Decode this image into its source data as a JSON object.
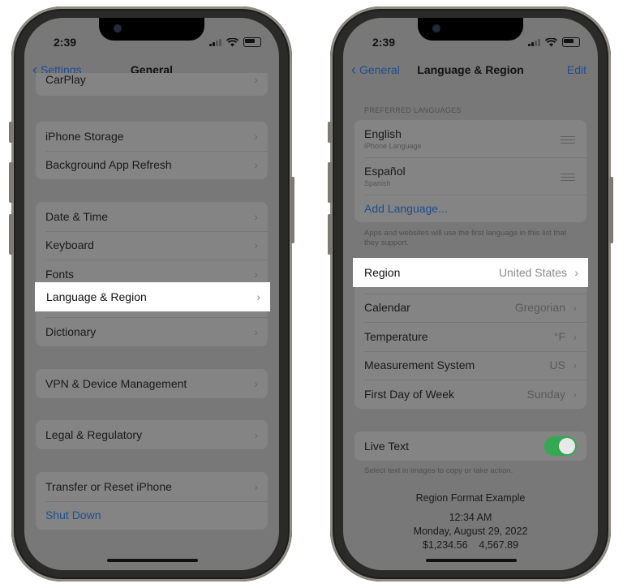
{
  "left_phone": {
    "status": {
      "time": "2:39"
    },
    "nav": {
      "back_label": "Settings",
      "title": "General"
    },
    "partial_row": "CarPlay",
    "group1": [
      "iPhone Storage",
      "Background App Refresh"
    ],
    "group2": [
      "Date & Time",
      "Keyboard",
      "Fonts",
      "Language & Region",
      "Dictionary"
    ],
    "group3": [
      "VPN & Device Management"
    ],
    "group4": [
      "Legal & Regulatory"
    ],
    "group5": [
      "Transfer or Reset iPhone"
    ],
    "shut_down": "Shut Down"
  },
  "right_phone": {
    "status": {
      "time": "2:39"
    },
    "nav": {
      "back_label": "General",
      "title": "Language & Region",
      "edit_label": "Edit"
    },
    "preferred_header": "PREFERRED LANGUAGES",
    "languages": [
      {
        "name": "English",
        "sub": "iPhone Language"
      },
      {
        "name": "Español",
        "sub": "Spanish"
      }
    ],
    "add_language": "Add Language...",
    "languages_caption": "Apps and websites will use the first language in this list that they support.",
    "settings": [
      {
        "label": "Region",
        "value": "United States"
      },
      {
        "label": "Calendar",
        "value": "Gregorian"
      },
      {
        "label": "Temperature",
        "value": "°F"
      },
      {
        "label": "Measurement System",
        "value": "US"
      },
      {
        "label": "First Day of Week",
        "value": "Sunday"
      }
    ],
    "live_text": {
      "label": "Live Text",
      "enabled": true,
      "caption": "Select text in images to copy or take action."
    },
    "format_example": {
      "title": "Region Format Example",
      "time": "12:34 AM",
      "date": "Monday, August 29, 2022",
      "numbers": "$1,234.56    4,567.89"
    }
  },
  "colors": {
    "accent": "#1f4d8f",
    "toggle_on": "#34a853",
    "highlight": "#ffffff"
  }
}
